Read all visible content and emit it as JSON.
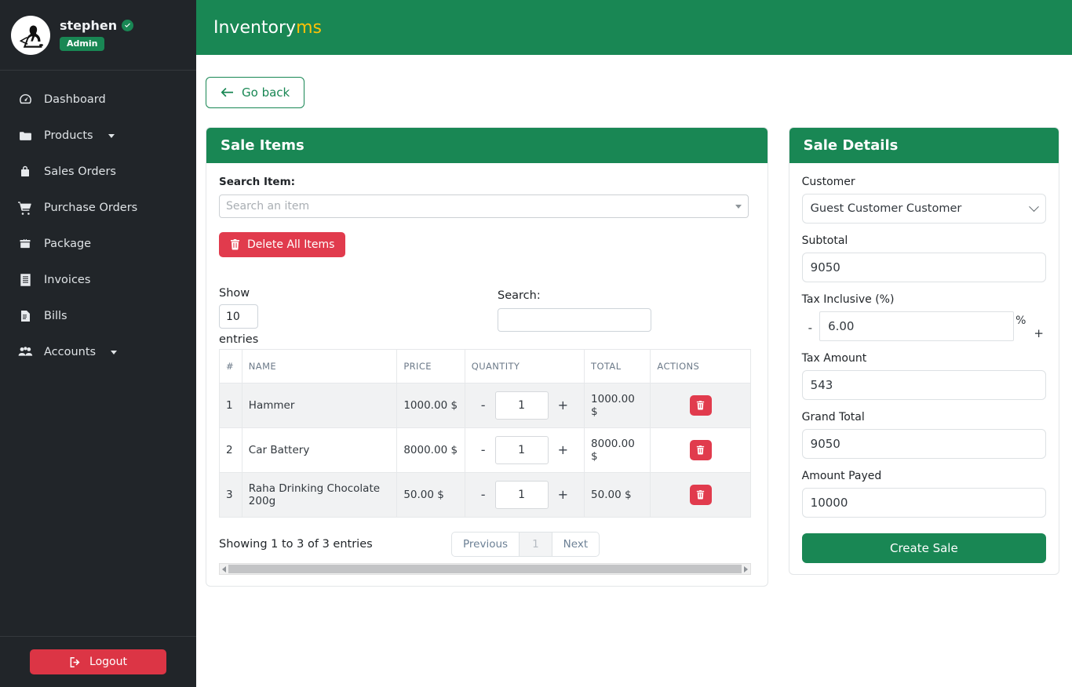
{
  "sidebar": {
    "user": {
      "name": "stephen",
      "role_badge": "Admin",
      "verified_icon": "check-circle-icon",
      "avatar_icon": "user-avatar-hacker-laptop"
    },
    "items": [
      {
        "label": "Dashboard",
        "icon": "dashboard-gauge-icon",
        "has_caret": false
      },
      {
        "label": "Products",
        "icon": "folder-icon",
        "has_caret": true
      },
      {
        "label": "Sales Orders",
        "icon": "lock-bag-icon",
        "has_caret": false
      },
      {
        "label": "Purchase Orders",
        "icon": "shopping-cart-icon",
        "has_caret": false
      },
      {
        "label": "Package",
        "icon": "box-package-icon",
        "has_caret": false
      },
      {
        "label": "Invoices",
        "icon": "invoice-list-icon",
        "has_caret": false
      },
      {
        "label": "Bills",
        "icon": "bill-document-icon",
        "has_caret": false
      },
      {
        "label": "Accounts",
        "icon": "users-group-icon",
        "has_caret": true
      }
    ],
    "logout": {
      "label": "Logout",
      "icon": "logout-arrow-icon"
    }
  },
  "topbar": {
    "logo_main": "Inventory",
    "logo_accent": "ms"
  },
  "toolbar": {
    "go_back_label": "Go back",
    "go_back_icon": "arrow-left-icon"
  },
  "sale_items": {
    "title": "Sale Items",
    "search_item_label": "Search Item:",
    "search_item_placeholder": "Search an item",
    "search_item_value": "",
    "delete_all_label": "Delete All Items",
    "delete_all_icon": "trash-icon",
    "show_label": "Show",
    "entries_label": "entries",
    "page_length": "10",
    "search_label": "Search:",
    "search_value": "",
    "search_placeholder": "",
    "columns": [
      "#",
      "NAME",
      "PRICE",
      "QUANTITY",
      "TOTAL",
      "ACTIONS"
    ],
    "rows": [
      {
        "idx": "1",
        "name": "Hammer",
        "price": "1000.00 $",
        "qty": "1",
        "total": "1000.00 $",
        "minus": "-",
        "plus": "+",
        "delete_icon": "trash-icon"
      },
      {
        "idx": "2",
        "name": "Car Battery",
        "price": "8000.00 $",
        "qty": "1",
        "total": "8000.00 $",
        "minus": "-",
        "plus": "+",
        "delete_icon": "trash-icon"
      },
      {
        "idx": "3",
        "name": "Raha Drinking Chocolate 200g",
        "price": "50.00 $",
        "qty": "1",
        "total": "50.00 $",
        "minus": "-",
        "plus": "+",
        "delete_icon": "trash-icon"
      }
    ],
    "info": "Showing 1 to 3 of 3 entries",
    "pagination": {
      "previous": "Previous",
      "page": "1",
      "next": "Next"
    }
  },
  "sale_details": {
    "title": "Sale Details",
    "customer_label": "Customer",
    "customer_value": "Guest Customer Customer",
    "subtotal_label": "Subtotal",
    "subtotal_value": "9050",
    "tax_inclusive_label": "Tax Inclusive (%)",
    "tax_inclusive_value": "6.00",
    "tax_minus": "-",
    "tax_plus": "+",
    "percent_sign": "%",
    "tax_amount_label": "Tax Amount",
    "tax_amount_value": "543",
    "grand_total_label": "Grand Total",
    "grand_total_value": "9050",
    "amount_payed_label": "Amount Payed",
    "amount_payed_value": "10000",
    "create_sale_label": "Create Sale"
  },
  "colors": {
    "brand_green": "#198754",
    "accent_yellow": "#ffc107",
    "danger_red": "#e13b4d",
    "sidebar_dark": "#212529"
  }
}
